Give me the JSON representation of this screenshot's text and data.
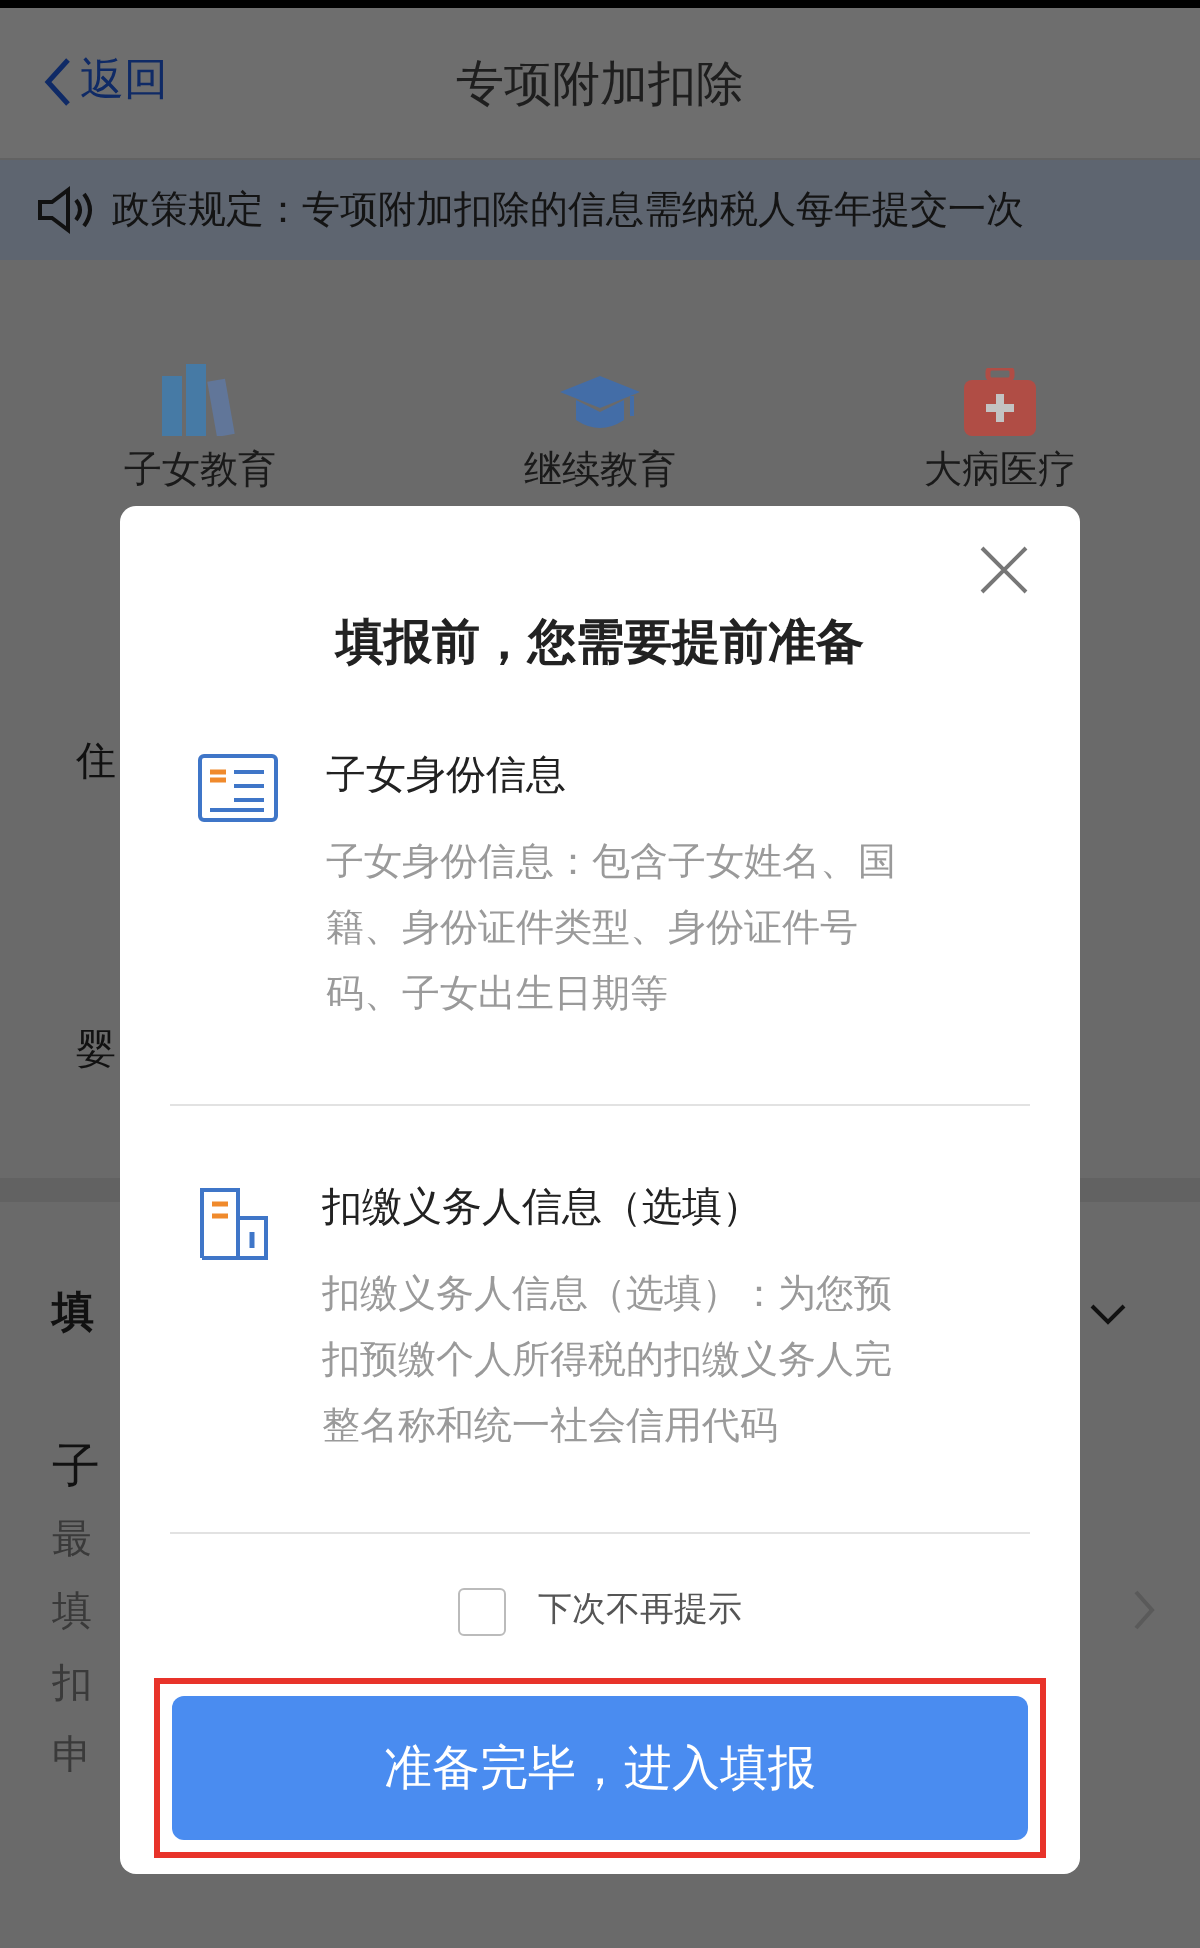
{
  "header": {
    "back": "返回",
    "title": "专项附加扣除"
  },
  "notice": "政策规定：专项附加扣除的信息需纳税人每年提交一次",
  "categories": [
    {
      "label": "子女教育",
      "kind": "books"
    },
    {
      "label": "继续教育",
      "kind": "cap"
    },
    {
      "label": "大病医疗",
      "kind": "medkit"
    }
  ],
  "side_labels": [
    "住",
    "婴"
  ],
  "section": {
    "heading": "填",
    "expanded": true
  },
  "list_item": {
    "title": "子",
    "lines": [
      "最",
      "填",
      "扣",
      "申"
    ]
  },
  "modal": {
    "title": "填报前，您需要提前准备",
    "items": [
      {
        "kind": "id-card",
        "title": "子女身份信息",
        "description": "子女身份信息：包含子女姓名、国籍、身份证件类型、身份证件号码、子女出生日期等"
      },
      {
        "kind": "building",
        "title": "扣缴义务人信息（选填）",
        "description": "扣缴义务人信息（选填）：为您预扣预缴个人所得税的扣缴义务人完整名称和统一社会信用代码"
      }
    ],
    "checkbox": {
      "label": "下次不再提示",
      "checked": false
    },
    "button": "准备完毕，进入填报",
    "button_highlighted": true
  }
}
